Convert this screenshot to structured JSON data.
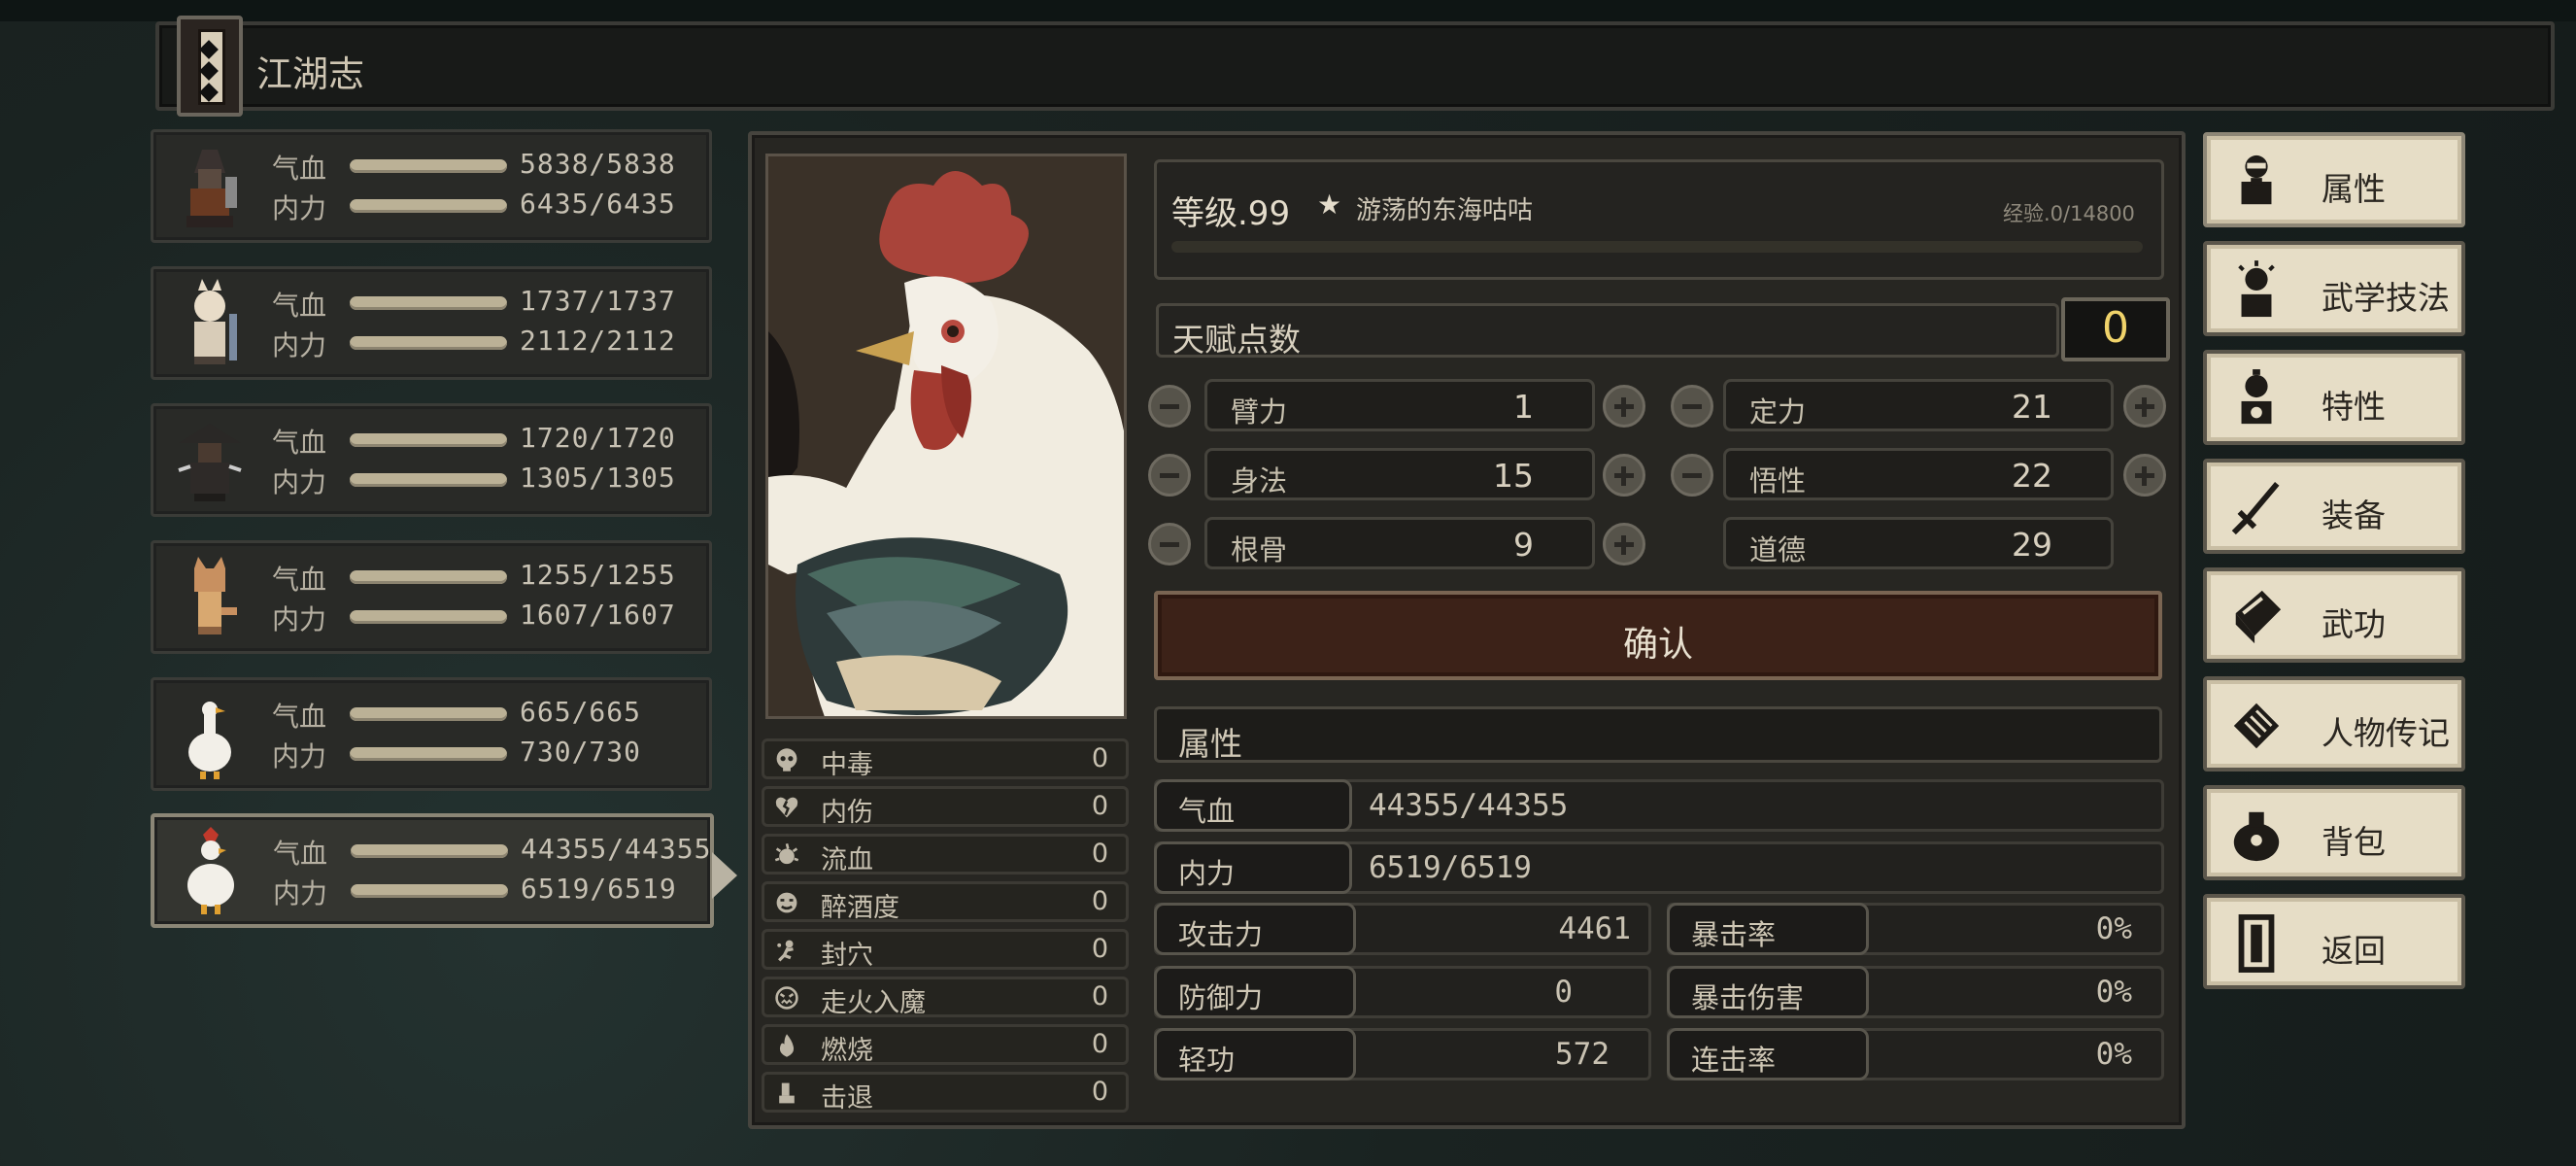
{
  "header": {
    "title": "江湖志"
  },
  "party": [
    {
      "hp_label": "气血",
      "mp_label": "内力",
      "hp": "5838/5838",
      "mp": "6435/6435"
    },
    {
      "hp_label": "气血",
      "mp_label": "内力",
      "hp": "1737/1737",
      "mp": "2112/2112"
    },
    {
      "hp_label": "气血",
      "mp_label": "内力",
      "hp": "1720/1720",
      "mp": "1305/1305"
    },
    {
      "hp_label": "气血",
      "mp_label": "内力",
      "hp": "1255/1255",
      "mp": "1607/1607"
    },
    {
      "hp_label": "气血",
      "mp_label": "内力",
      "hp": "665/665",
      "mp": "730/730"
    },
    {
      "hp_label": "气血",
      "mp_label": "内力",
      "hp": "44355/44355",
      "mp": "6519/6519"
    }
  ],
  "status_effects": [
    {
      "name": "中毒",
      "value": "0",
      "icon": "skull-icon"
    },
    {
      "name": "内伤",
      "value": "0",
      "icon": "broken-heart-icon"
    },
    {
      "name": "流血",
      "value": "0",
      "icon": "blood-splash-icon"
    },
    {
      "name": "醉酒度",
      "value": "0",
      "icon": "drunk-face-icon"
    },
    {
      "name": "封穴",
      "value": "0",
      "icon": "acupoint-icon"
    },
    {
      "name": "走火入魔",
      "value": "0",
      "icon": "demon-face-icon"
    },
    {
      "name": "燃烧",
      "value": "0",
      "icon": "flame-icon"
    },
    {
      "name": "击退",
      "value": "0",
      "icon": "boot-icon"
    }
  ],
  "level": {
    "label": "等级.99",
    "star": "★",
    "nickname": "游荡的东海咕咕",
    "exp": "经验.0/14800",
    "exp_progress": 0
  },
  "talent": {
    "label": "天赋点数",
    "value": "0"
  },
  "attributes": [
    {
      "name": "臂力",
      "value": "1"
    },
    {
      "name": "定力",
      "value": "21"
    },
    {
      "name": "身法",
      "value": "15"
    },
    {
      "name": "悟性",
      "value": "22"
    },
    {
      "name": "根骨",
      "value": "9"
    },
    {
      "name": "道德",
      "value": "29"
    }
  ],
  "confirm_label": "确认",
  "stats_title": "属性",
  "stats": {
    "hp": {
      "label": "气血",
      "value": "44355/44355"
    },
    "mp": {
      "label": "内力",
      "value": "6519/6519"
    },
    "atk": {
      "label": "攻击力",
      "value": "4461"
    },
    "crit": {
      "label": "暴击率",
      "value": "0%"
    },
    "def": {
      "label": "防御力",
      "value": "0"
    },
    "critdmg": {
      "label": "暴击伤害",
      "value": "0%"
    },
    "agi": {
      "label": "轻功",
      "value": "572"
    },
    "combo": {
      "label": "连击率",
      "value": "0%"
    }
  },
  "menu": [
    {
      "label": "属性",
      "icon": "person-icon"
    },
    {
      "label": "武学技法",
      "icon": "person-spark-icon"
    },
    {
      "label": "特性",
      "icon": "person-trait-icon"
    },
    {
      "label": "装备",
      "icon": "sword-icon"
    },
    {
      "label": "武功",
      "icon": "book-icon"
    },
    {
      "label": "人物传记",
      "icon": "scroll-icon"
    },
    {
      "label": "背包",
      "icon": "bag-icon"
    },
    {
      "label": "返回",
      "icon": "door-icon"
    }
  ],
  "colors": {
    "accent": "#f0d36a",
    "confirm_bg": "#3c2218",
    "menu_bg": "#e6ddc6",
    "bar": "#bbb196"
  }
}
